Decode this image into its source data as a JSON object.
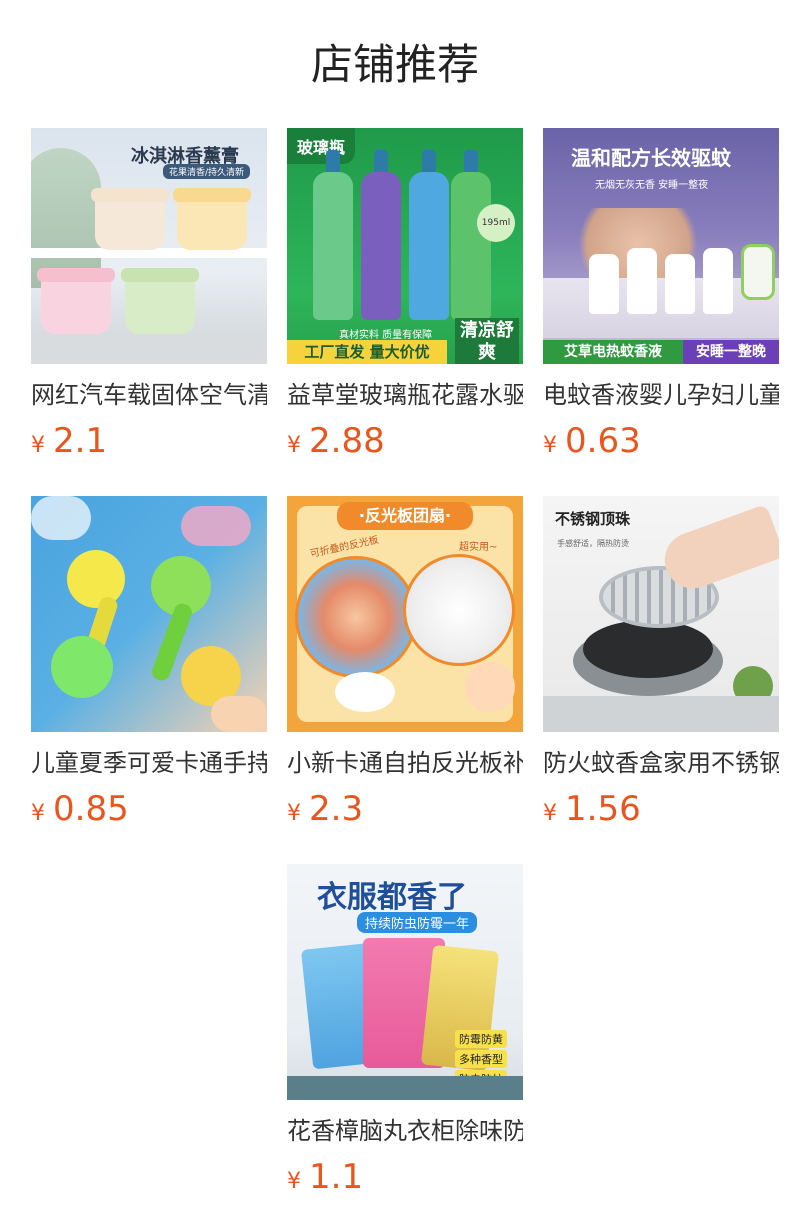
{
  "page": {
    "title": "店铺推荐"
  },
  "products": [
    {
      "name": "网红汽车载固体空气清新剂香薰膏",
      "currency": "¥",
      "price": "2.1",
      "image_text": {
        "headline": "冰淇淋香薰膏",
        "sub": "花果清香/持久清新"
      }
    },
    {
      "name": "益草堂玻璃瓶花露水驱蚊止痒",
      "currency": "¥",
      "price": "2.88",
      "image_text": {
        "corner": "玻璃瓶",
        "volume": "195ml",
        "promise": "真材实料 质量有保障",
        "strip": "工厂直发 量大价优",
        "badge": "清凉舒爽"
      }
    },
    {
      "name": "电蚊香液婴儿孕妇儿童无味驱蚊",
      "currency": "¥",
      "price": "0.63",
      "image_text": {
        "headline": "温和配方长效驱蚊",
        "sub": "无烟无灰无香 安睡一整夜",
        "left_strip": "艾草电热蚊香液",
        "right_strip": "安睡一整晚"
      }
    },
    {
      "name": "儿童夏季可爱卡通手持小风扇",
      "currency": "¥",
      "price": "0.85"
    },
    {
      "name": "小新卡通自拍反光板补光",
      "currency": "¥",
      "price": "2.3",
      "image_text": {
        "banner": "·反光板团扇·",
        "left_tag": "可折叠的反光板",
        "right_tag": "超实用~"
      }
    },
    {
      "name": "防火蚊香盒家用不锈钢蚊香架",
      "currency": "¥",
      "price": "1.56",
      "image_text": {
        "headline": "不锈钢顶珠",
        "sub": "手感舒适，隔热防烫"
      }
    },
    {
      "name": "花香樟脑丸衣柜除味防虫",
      "currency": "¥",
      "price": "1.1",
      "image_text": {
        "headline": "衣服都香了",
        "sub": "持续防虫防霉一年",
        "tag1": "防霉防黄",
        "tag2": "多种香型",
        "tag3": "防虫防蛀"
      }
    }
  ]
}
